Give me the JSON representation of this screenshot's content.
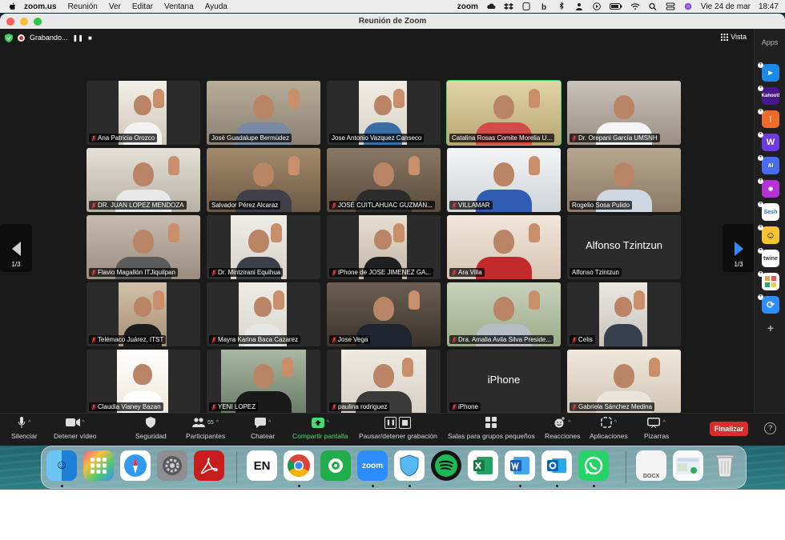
{
  "menubar": {
    "app": "zoom.us",
    "items": [
      "Reunión",
      "Ver",
      "Editar",
      "Ventana",
      "Ayuda"
    ],
    "zoom_label": "zoom",
    "datetime_day": "Vie 24 de mar",
    "datetime_time": "18:47"
  },
  "window": {
    "title": "Reunión de Zoom"
  },
  "meeting": {
    "recording_label": "Grabando...",
    "view_label": "Vista",
    "apps_label": "Apps",
    "page_left": "1/3",
    "page_right": "1/3"
  },
  "participants": [
    {
      "name": "Ana Patricia Orozco",
      "muted": true
    },
    {
      "name": "José Guadalupe Bermúdez",
      "muted": false
    },
    {
      "name": "Jose Antonio Vazquez Canseco",
      "muted": false
    },
    {
      "name": "Catalina Rosas Comite Morelia U...",
      "muted": false,
      "active": true
    },
    {
      "name": "Dr. Orepani García UMSNH",
      "muted": true
    },
    {
      "name": "DR. JUAN LOPEZ MENDOZA",
      "muted": true
    },
    {
      "name": "Salvador Pérez Alcaraz",
      "muted": false
    },
    {
      "name": "JOSÉ CUITLAHUAC GUZMÁN...",
      "muted": true
    },
    {
      "name": "VILLAMAR",
      "muted": true
    },
    {
      "name": "Rogelio Sosa Pulido",
      "muted": false
    },
    {
      "name": "Flavio Magallón ITJiquilpan",
      "muted": true
    },
    {
      "name": "Dr. Mintzirani Equihua",
      "muted": true
    },
    {
      "name": "iPhone de JOSE JIMENEZ GA...",
      "muted": true
    },
    {
      "name": "Ara Villa",
      "muted": true
    },
    {
      "name": "Alfonso Tzintzun",
      "muted": false,
      "big_name": "Alfonso Tzintzun"
    },
    {
      "name": "Telémaco Juárez, ITST",
      "muted": true
    },
    {
      "name": "Mayra Karina Baca Cazarez",
      "muted": true
    },
    {
      "name": "Jose Vega",
      "muted": true
    },
    {
      "name": "Dra. Amalia Avila Silva Preside...",
      "muted": true
    },
    {
      "name": "Celis",
      "muted": true
    },
    {
      "name": "Claudia Vianey Bazan",
      "muted": true
    },
    {
      "name": "YENI LOPEZ",
      "muted": true
    },
    {
      "name": "paulina rodriguez",
      "muted": true
    },
    {
      "name": "iPhone",
      "muted": true,
      "big_name": "iPhone"
    },
    {
      "name": "Gabriela Sánchez Medina",
      "muted": true
    }
  ],
  "toolbar": {
    "mute": "Silenciar",
    "video": "Detener vídeo",
    "security": "Seguridad",
    "participants": "Participantes",
    "participants_count": "55",
    "chat": "Chatear",
    "share": "Compartir pantalla",
    "recording": "Pausar/detener grabación",
    "breakout": "Salas para grupos pequeños",
    "reactions": "Reacciones",
    "apps": "Aplicaciones",
    "whiteboards": "Pizarras",
    "end": "Finalizar",
    "help": "?"
  },
  "dock": {
    "en_label": "EN",
    "zoom_label": "zoom",
    "docx_label": "DOCX"
  },
  "side_apps": {
    "kahoot": "Kahoot!",
    "ai": "AI",
    "sesh": "Sesh",
    "twine": "twine",
    "add": "+"
  }
}
